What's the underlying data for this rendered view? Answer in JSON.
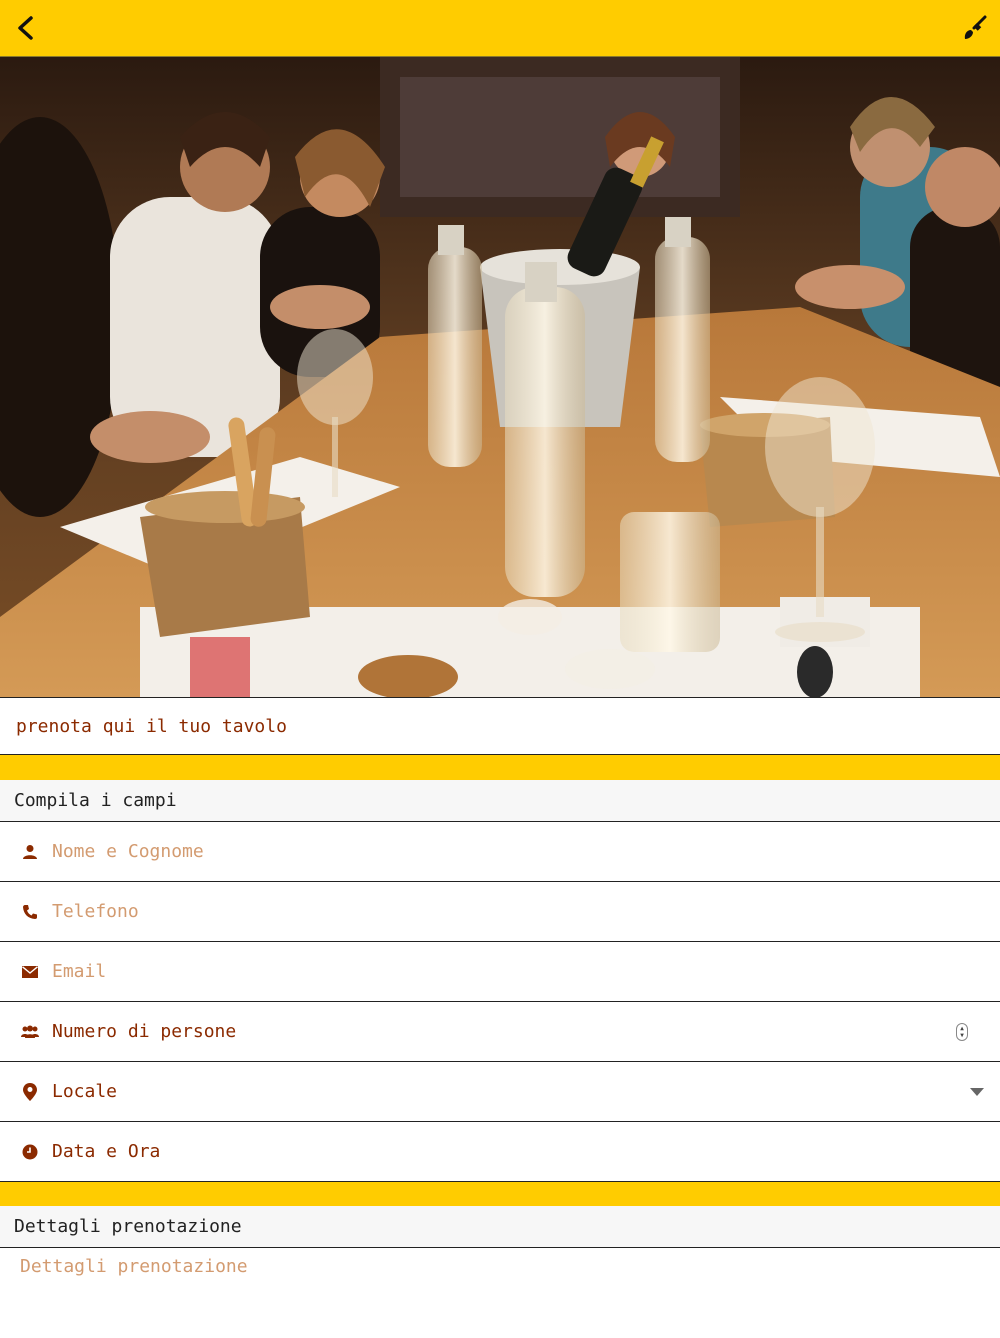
{
  "header": {
    "back_icon": "chevron-left-icon",
    "brush_icon": "paint-brush-icon",
    "background_color": "#ffcc00"
  },
  "hero": {
    "image_icon": "restaurant-dinner-photo"
  },
  "tagline": "prenota qui il tuo tavolo",
  "form": {
    "section_title": "Compila i campi",
    "name_placeholder": "Nome e Cognome",
    "phone_placeholder": "Telefono",
    "email_placeholder": "Email",
    "people_label": "Numero di persone",
    "venue_label": "Locale",
    "datetime_label": "Data e Ora"
  },
  "details": {
    "section_title": "Dettagli prenotazione",
    "placeholder": "Dettagli prenotazione"
  },
  "colors": {
    "accent": "#ffcc00",
    "text_brown": "#8b2a00",
    "placeholder": "#d39b70"
  }
}
